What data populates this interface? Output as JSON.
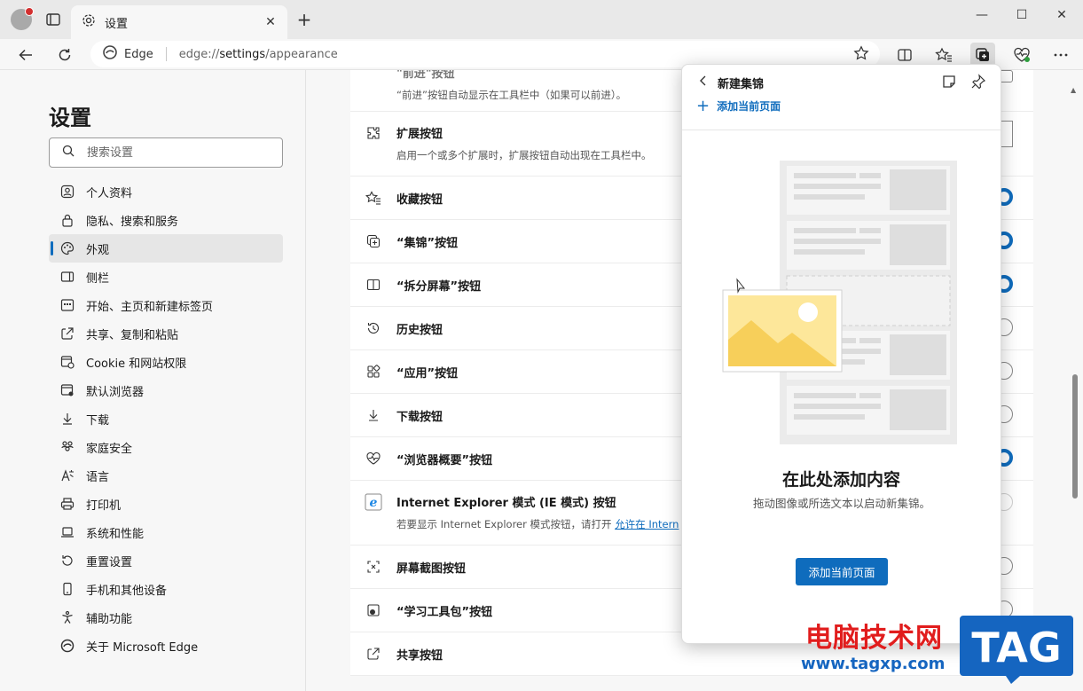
{
  "browser": {
    "tab_title": "设置",
    "tab_close": "✕",
    "new_tab": "+",
    "window_controls": {
      "minimize": "—",
      "maximize": "☐",
      "close": "✕"
    }
  },
  "address_bar": {
    "site_label": "Edge",
    "url_prefix": "edge://",
    "url_main": "settings",
    "url_suffix": "/appearance"
  },
  "sidebar": {
    "title": "设置",
    "search_placeholder": "搜索设置",
    "items": [
      {
        "label": "个人资料",
        "icon": "profile-icon"
      },
      {
        "label": "隐私、搜索和服务",
        "icon": "lock-icon"
      },
      {
        "label": "外观",
        "icon": "palette-icon",
        "active": true
      },
      {
        "label": "侧栏",
        "icon": "sidebar-icon"
      },
      {
        "label": "开始、主页和新建标签页",
        "icon": "home-grid-icon"
      },
      {
        "label": "共享、复制和粘贴",
        "icon": "share-icon"
      },
      {
        "label": "Cookie 和网站权限",
        "icon": "cookie-icon"
      },
      {
        "label": "默认浏览器",
        "icon": "browser-icon"
      },
      {
        "label": "下载",
        "icon": "download-icon"
      },
      {
        "label": "家庭安全",
        "icon": "family-icon"
      },
      {
        "label": "语言",
        "icon": "language-icon"
      },
      {
        "label": "打印机",
        "icon": "printer-icon"
      },
      {
        "label": "系统和性能",
        "icon": "laptop-icon"
      },
      {
        "label": "重置设置",
        "icon": "reset-icon"
      },
      {
        "label": "手机和其他设备",
        "icon": "phone-icon"
      },
      {
        "label": "辅助功能",
        "icon": "accessibility-icon"
      },
      {
        "label": "关于 Microsoft Edge",
        "icon": "edge-logo-icon"
      }
    ]
  },
  "content": {
    "partial_row_label": "\"前进\"按钮",
    "partial_row_desc": "“前进”按钮自动显示在工具栏中（如果可以前进）。",
    "rows": [
      {
        "label": "扩展按钮",
        "desc": "启用一个或多个扩展时，扩展按钮自动出现在工具栏中。",
        "icon": "puzzle-icon",
        "toggle": "none"
      },
      {
        "label": "收藏按钮",
        "icon": "favorites-icon",
        "toggle": "on"
      },
      {
        "label": "“集锦”按钮",
        "icon": "collections-icon",
        "toggle": "on"
      },
      {
        "label": "“拆分屏幕”按钮",
        "icon": "split-screen-icon",
        "toggle": "on"
      },
      {
        "label": "历史按钮",
        "icon": "history-icon",
        "toggle": "off"
      },
      {
        "label": "“应用”按钮",
        "icon": "apps-icon",
        "toggle": "off"
      },
      {
        "label": "下载按钮",
        "icon": "download-icon",
        "toggle": "off"
      },
      {
        "label": "“浏览器概要”按钮",
        "icon": "heartbeat-icon",
        "toggle": "on"
      },
      {
        "label": "Internet Explorer 模式 (IE 模式) 按钮",
        "desc": "若要显示 Internet Explorer 模式按钮，请打开 ",
        "link": "允许在 Intern",
        "icon": "ie-icon",
        "toggle": "off"
      },
      {
        "label": "屏幕截图按钮",
        "icon": "screenshot-icon",
        "toggle": "off"
      },
      {
        "label": "“学习工具包”按钮",
        "icon": "learning-toolkit-icon",
        "toggle": "off"
      },
      {
        "label": "共享按钮",
        "icon": "share-icon",
        "toggle": "none"
      }
    ]
  },
  "collections_panel": {
    "title": "新建集锦",
    "add_current_link": "添加当前页面",
    "heading": "在此处添加内容",
    "description": "拖动图像或所选文本以启动新集锦。",
    "button_label": "添加当前页面"
  },
  "watermark": {
    "cn_text": "电脑技术网",
    "url": "www.tagxp.com",
    "tag": "TAG"
  },
  "colors": {
    "accent": "#0f6cbd",
    "watermark_red": "#e11d1d",
    "watermark_blue": "#1565c0"
  }
}
